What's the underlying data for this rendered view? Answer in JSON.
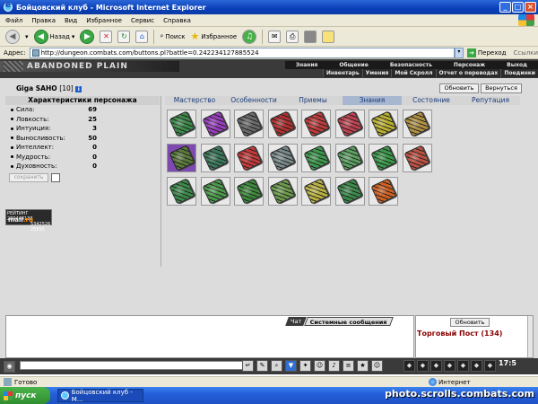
{
  "window": {
    "title": "Бойцовский клуб - Microsoft Internet Explorer",
    "minimize": "_",
    "maximize": "□",
    "close": "×"
  },
  "menu": [
    "Файл",
    "Правка",
    "Вид",
    "Избранное",
    "Сервис",
    "Справка"
  ],
  "toolbar": {
    "back_label": "Назад",
    "search_label": "Поиск",
    "favorites_label": "Избранное"
  },
  "address": {
    "label": "Адрес:",
    "url": "http://dungeon.combats.com/buttons.pl?battle=0.242234127885524",
    "go_label": "Переход",
    "links_label": "Ссылки"
  },
  "game": {
    "banner": "ABANDONED PLAIN",
    "nav_top": [
      "Знания",
      "Общение",
      "Безопасность",
      "Персонаж",
      "Выход"
    ],
    "nav_sub": [
      "Инвентарь",
      "Умения",
      "Мой Скролл",
      "Отчет о переводах",
      "Поединки"
    ],
    "character": {
      "name": "Giga SAHO",
      "level": "[10]"
    },
    "refresh_label": "Обновить",
    "return_label": "Вернуться",
    "stats_title": "Характеристики персонажа",
    "stats": [
      {
        "name": "Сила:",
        "value": "69"
      },
      {
        "name": "Ловкость:",
        "value": "25"
      },
      {
        "name": "Интуиция:",
        "value": "3"
      },
      {
        "name": "Выносливость:",
        "value": "50"
      },
      {
        "name": "Интеллект:",
        "value": "0"
      },
      {
        "name": "Мудрость:",
        "value": "0"
      },
      {
        "name": "Духовность:",
        "value": "0"
      }
    ],
    "save_label": "сохранить",
    "tabs": [
      "Мастерство",
      "Особенности",
      "Приемы",
      "Знания",
      "Состояние",
      "Репутация"
    ],
    "active_tab": "Знания",
    "counter": {
      "line1": "РЕЙТИНГ 289444136",
      "line2a": "5342526",
      "line2b": "25595",
      "brand": "mail",
      "brand_ru": ".ru"
    },
    "scroll_colors": [
      "#3c8a4a",
      "#9a3cc0",
      "#6a6a6a",
      "#b03030",
      "#c03a3a",
      "#c04050",
      "#b8b030",
      "#b09040",
      "#5a7a3a",
      "#3a7a5a",
      "#c83838",
      "#7a8a8a",
      "#3c9a4c",
      "#5aa060",
      "#3a9a4a",
      "#c05040",
      "#3a8a4a",
      "#4a9a4a",
      "#3a8a3a",
      "#6a9a4a",
      "#b8b040",
      "#3a8a4a",
      "#d06020"
    ],
    "chat_tabs": [
      "Чат",
      "Системные сообщения"
    ],
    "refresh2_label": "Обновить",
    "post_title": "Торговый Пост (134)",
    "bottom_icons": [
      "✎",
      "⌕",
      "▼",
      "✦",
      "☺",
      "♪",
      "≡",
      "★",
      "☺",
      "⚙",
      "◧"
    ],
    "clock": "17:5"
  },
  "status": {
    "text": "Готово",
    "zone": "Интернет"
  },
  "taskbar": {
    "start": "пуск",
    "task": "Бойцовский клуб - M...",
    "watermark": "photo.scrolls.combats.com"
  }
}
